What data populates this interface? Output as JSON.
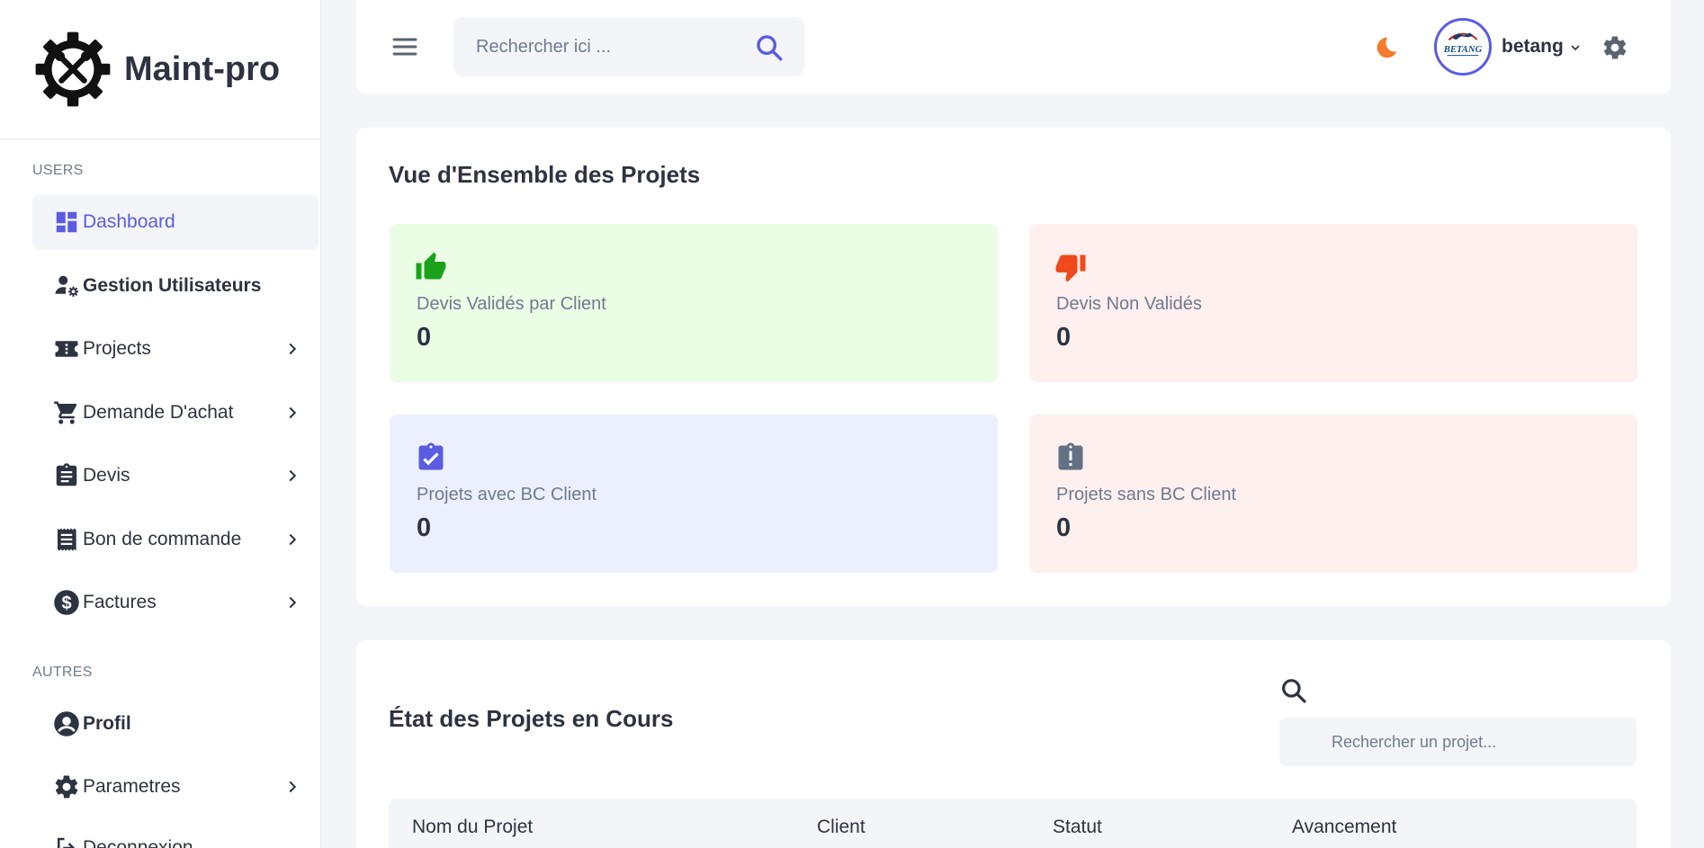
{
  "sidebar": {
    "brand": "Maint-pro",
    "section_users": "USERS",
    "section_autres": "AUTRES",
    "items": [
      {
        "label": "Dashboard",
        "icon": "dashboard-icon"
      },
      {
        "label": "Gestion Utilisateurs",
        "icon": "user-gear-icon"
      },
      {
        "label": "Projects",
        "icon": "ticket-icon"
      },
      {
        "label": "Demande D'achat",
        "icon": "cart-icon"
      },
      {
        "label": "Devis",
        "icon": "clipboard-icon"
      },
      {
        "label": "Bon de commande",
        "icon": "receipt-icon"
      },
      {
        "label": "Factures",
        "icon": "dollar-icon"
      },
      {
        "label": "Profil",
        "icon": "user-circle-icon"
      },
      {
        "label": "Parametres",
        "icon": "gear-icon"
      },
      {
        "label": "Deconnexion",
        "icon": "logout-icon"
      }
    ]
  },
  "header": {
    "search_placeholder": "Rechercher ici ...",
    "username": "betang",
    "avatar_text": "BETANG"
  },
  "overview": {
    "title": "Vue d'Ensemble des Projets",
    "stats": [
      {
        "label": "Devis Validés par Client",
        "value": "0",
        "icon": "thumbs-up-icon",
        "bg": "#ecfde6",
        "icon_color": "#1aa31a"
      },
      {
        "label": "Devis Non Validés",
        "value": "0",
        "icon": "thumbs-down-icon",
        "bg": "#fef0ee",
        "icon_color": "#f04a1c"
      },
      {
        "label": "Projets avec BC Client",
        "value": "0",
        "icon": "clipboard-check-icon",
        "bg": "#ecf0fe",
        "icon_color": "#5b5ce2"
      },
      {
        "label": "Projets sans BC Client",
        "value": "0",
        "icon": "clipboard-alert-icon",
        "bg": "#fef0ee",
        "icon_color": "#637184"
      }
    ]
  },
  "projects": {
    "title": "État des Projets en Cours",
    "search_placeholder": "Rechercher un projet...",
    "columns": [
      "Nom du Projet",
      "Client",
      "Statut",
      "Avancement"
    ]
  },
  "colors": {
    "accent": "#5b5ce2",
    "theme_icon": "#f47a2e"
  }
}
